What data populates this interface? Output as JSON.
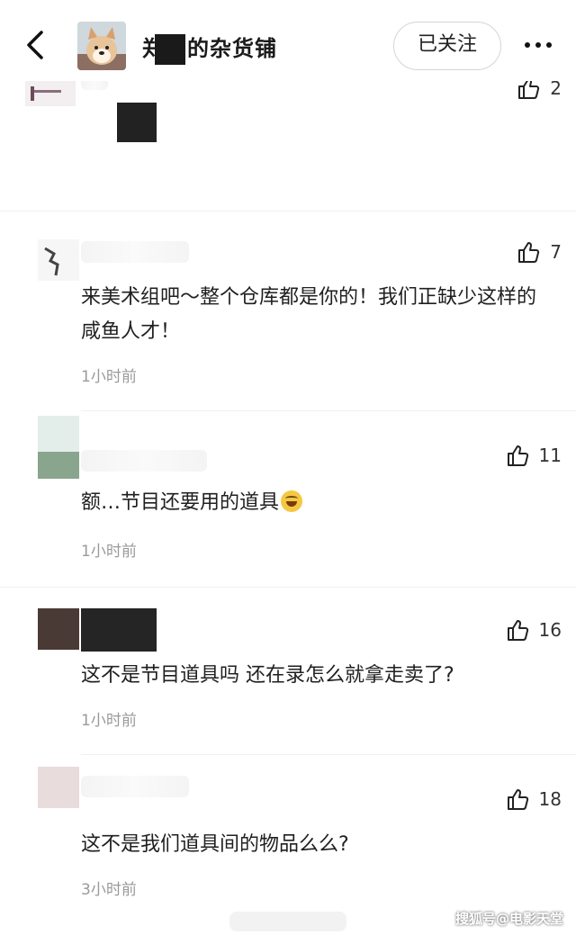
{
  "header": {
    "title": "郑惠的杂货铺",
    "follow_label": "已关注"
  },
  "comments": [
    {
      "likes": "2",
      "content": "",
      "time": ""
    },
    {
      "likes": "7",
      "content": "来美术组吧～整个仓库都是你的！我们正缺少这样的咸鱼人才！",
      "time": "1小时前"
    },
    {
      "likes": "11",
      "content": "额…节目还要用的道具",
      "time": "1小时前"
    },
    {
      "likes": "16",
      "content": "这不是节目道具吗 还在录怎么就拿走卖了?",
      "time": "1小时前"
    },
    {
      "likes": "18",
      "content": "这不是我们道具间的物品么么?",
      "time": "3小时前"
    }
  ],
  "watermark": "搜狐号@电影天堂",
  "colors": {
    "text": "#1f1f1f",
    "muted": "#9a9a9a",
    "divider": "#f0f0f0"
  },
  "icons": [
    "back-arrow-icon",
    "more-icon",
    "thumb-up-icon",
    "laugh-cry-emoji-icon"
  ]
}
